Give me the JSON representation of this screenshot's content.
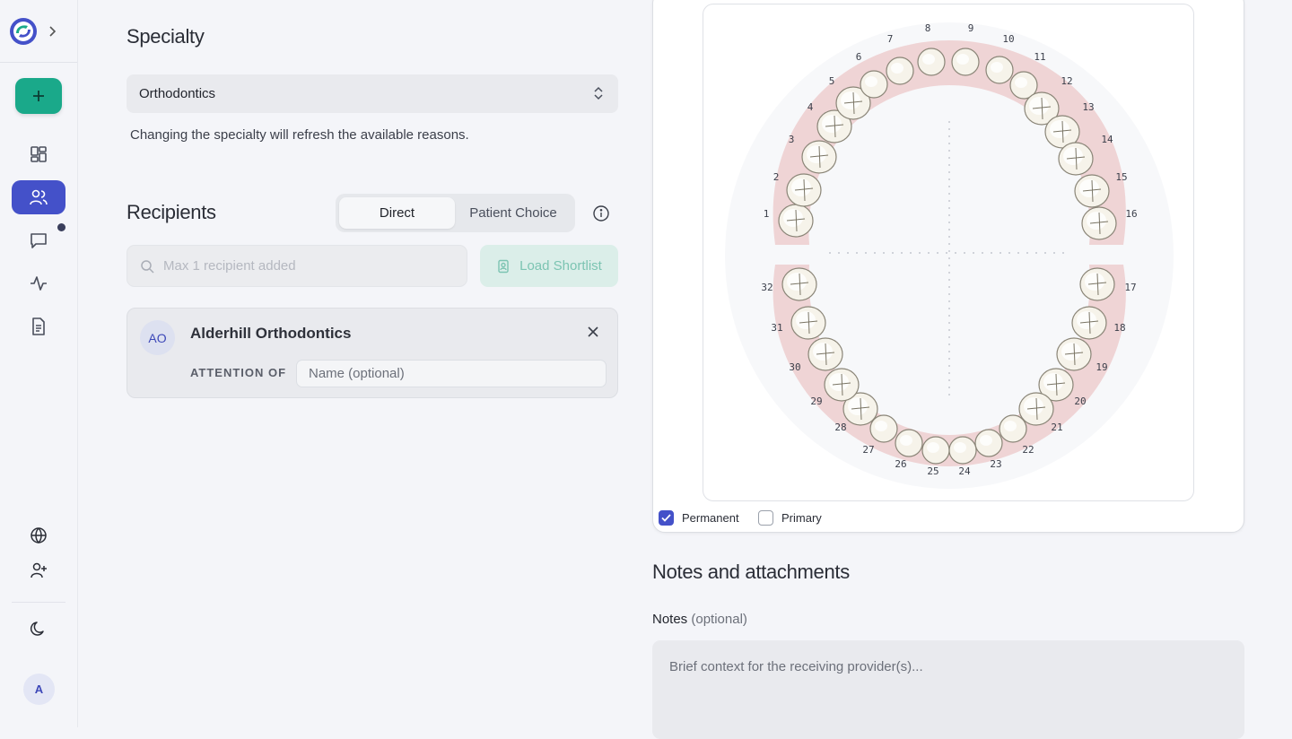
{
  "sidebar": {
    "logo": "app-logo-icon",
    "expand_icon": "chevron-right-icon",
    "new_button_icon": "plus-icon",
    "nav": [
      {
        "name": "dashboard",
        "icon": "grid-icon",
        "active": false
      },
      {
        "name": "patients",
        "icon": "users-icon",
        "active": true
      },
      {
        "name": "messages",
        "icon": "chat-icon",
        "active": false,
        "badge": true
      },
      {
        "name": "activity",
        "icon": "pulse-icon",
        "active": false
      },
      {
        "name": "documents",
        "icon": "document-icon",
        "active": false
      }
    ],
    "bottom": [
      {
        "name": "language",
        "icon": "globe-icon"
      },
      {
        "name": "invite",
        "icon": "user-plus-icon"
      },
      {
        "name": "theme",
        "icon": "moon-icon"
      }
    ],
    "avatar_initial": "A"
  },
  "specialty": {
    "title": "Specialty",
    "selected": "Orthodontics",
    "helper": "Changing the specialty will refresh the available reasons."
  },
  "recipients": {
    "title": "Recipients",
    "tabs": [
      {
        "label": "Direct",
        "selected": true
      },
      {
        "label": "Patient Choice",
        "selected": false
      }
    ],
    "search_placeholder": "Max 1 recipient added",
    "load_shortlist": "Load Shortlist",
    "card": {
      "initials": "AO",
      "name": "Alderhill Orthodontics",
      "attention_label": "ATTENTION OF",
      "attention_placeholder": "Name (optional)"
    }
  },
  "tooth_chart": {
    "upper": [
      "1",
      "2",
      "3",
      "4",
      "5",
      "6",
      "7",
      "8",
      "9",
      "10",
      "11",
      "12",
      "13",
      "14",
      "15",
      "16"
    ],
    "lower": [
      "17",
      "18",
      "19",
      "20",
      "21",
      "22",
      "23",
      "24",
      "25",
      "26",
      "27",
      "28",
      "29",
      "30",
      "31",
      "32"
    ],
    "options": [
      {
        "label": "Permanent",
        "checked": true
      },
      {
        "label": "Primary",
        "checked": false
      }
    ]
  },
  "notes": {
    "title": "Notes and attachments",
    "label": "Notes",
    "label_optional": "(optional)",
    "placeholder": "Brief context for the receiving provider(s)..."
  },
  "colors": {
    "accent": "#4451c9",
    "teal": "#1aa98a",
    "gum": "#e9b7b7"
  }
}
